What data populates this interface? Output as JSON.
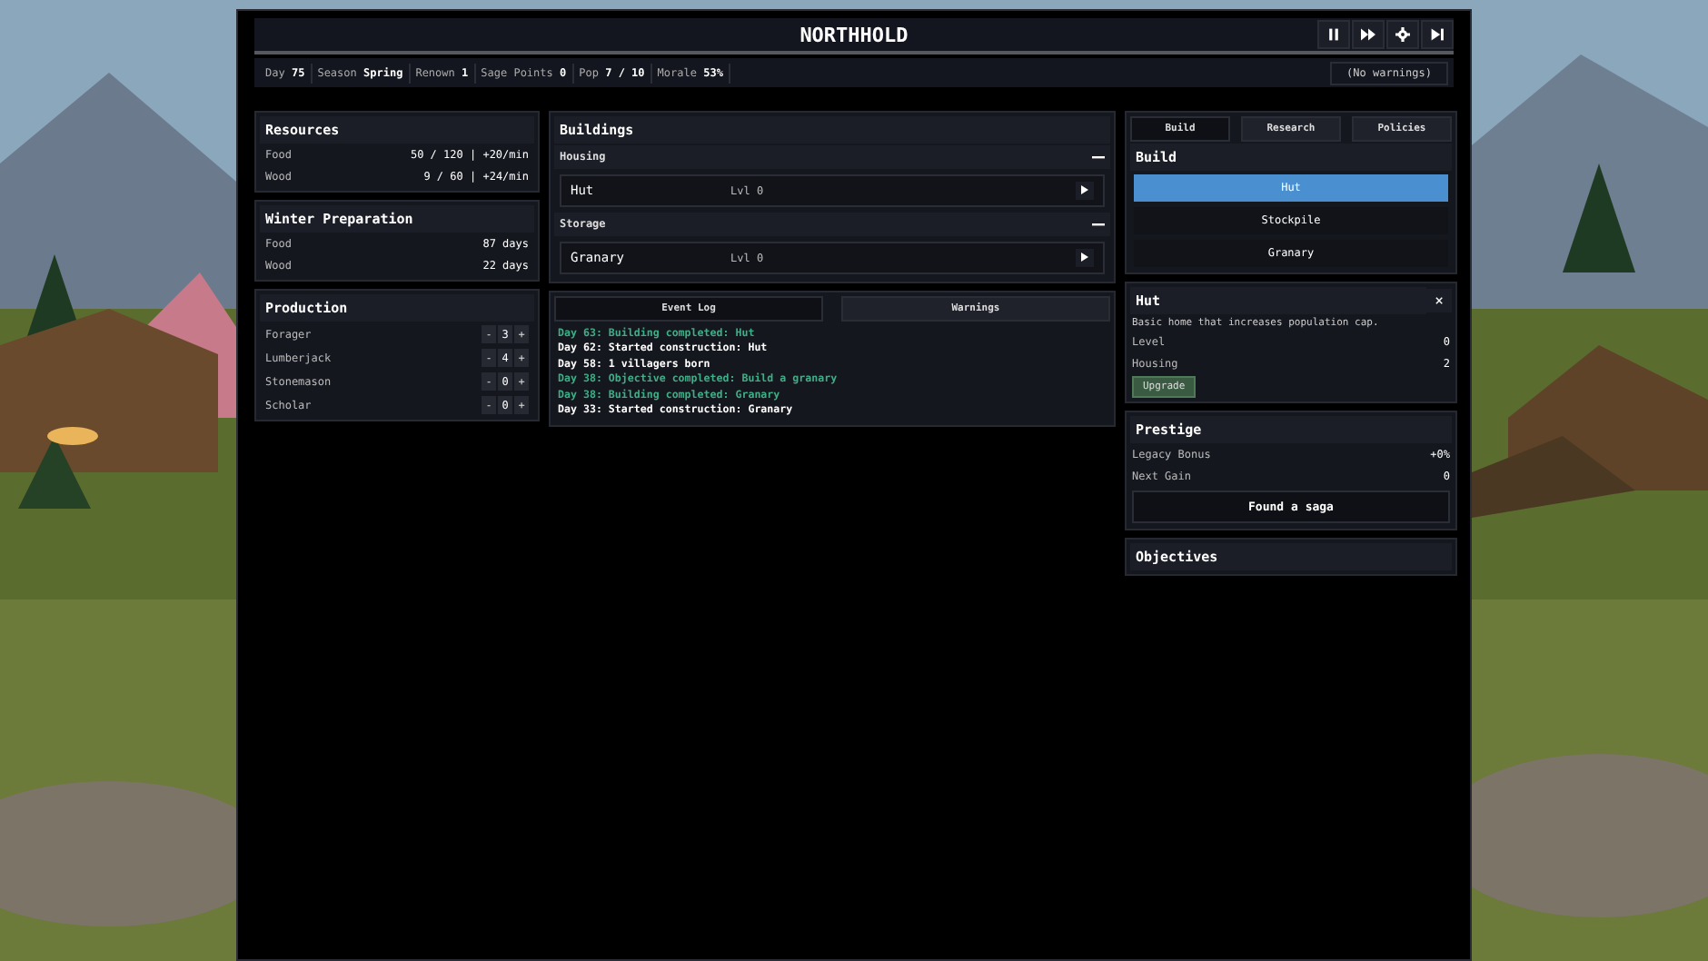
{
  "title": "NORTHHOLD",
  "controls": [
    {
      "kind": "pause"
    },
    {
      "kind": "fast"
    },
    {
      "kind": "settings"
    },
    {
      "kind": "skip"
    }
  ],
  "stats": [
    {
      "label": "Day",
      "value": "75"
    },
    {
      "label": "Season",
      "value": "Spring"
    },
    {
      "label": "Renown",
      "value": "1"
    },
    {
      "label": "Sage Points",
      "value": "0"
    },
    {
      "label": "Pop",
      "value": "7 / 10"
    },
    {
      "label": "Morale",
      "value": "53%"
    }
  ],
  "warnings_badge": "(No warnings)",
  "resources": {
    "title": "Resources",
    "rows": [
      {
        "label": "Food",
        "value": "50 / 120 | +20/min"
      },
      {
        "label": "Wood",
        "value": "9 / 60 | +24/min"
      }
    ]
  },
  "winter": {
    "title": "Winter Preparation",
    "rows": [
      {
        "label": "Food",
        "value": "87 days"
      },
      {
        "label": "Wood",
        "value": "22 days"
      }
    ]
  },
  "production": {
    "title": "Production",
    "minus": "-",
    "plus": "+",
    "rows": [
      {
        "label": "Forager",
        "count": "3"
      },
      {
        "label": "Lumberjack",
        "count": "4"
      },
      {
        "label": "Stonemason",
        "count": "0"
      },
      {
        "label": "Scholar",
        "count": "0"
      }
    ]
  },
  "buildings": {
    "title": "Buildings",
    "groups": [
      {
        "name": "Housing",
        "expanded": true,
        "items": [
          {
            "name": "Hut",
            "level": "Lvl 0"
          }
        ]
      },
      {
        "name": "Storage",
        "expanded": true,
        "items": [
          {
            "name": "Granary",
            "level": "Lvl 0"
          }
        ]
      }
    ]
  },
  "log": {
    "tabs": [
      {
        "label": "Event Log",
        "selected": true
      },
      {
        "label": "Warnings",
        "selected": false
      }
    ],
    "entries": [
      {
        "text": "Day 63: Building completed: Hut",
        "kind": "success"
      },
      {
        "text": "Day 62: Started construction: Hut",
        "kind": "info"
      },
      {
        "text": "Day 58: 1 villagers born",
        "kind": "info"
      },
      {
        "text": "Day 38: Objective completed: Build a granary",
        "kind": "success"
      },
      {
        "text": "Day 38: Building completed: Granary",
        "kind": "success"
      },
      {
        "text": "Day 33: Started construction: Granary",
        "kind": "info"
      }
    ]
  },
  "side_tabs": [
    {
      "label": "Build",
      "selected": true
    },
    {
      "label": "Research",
      "selected": false
    },
    {
      "label": "Policies",
      "selected": false
    }
  ],
  "build": {
    "title": "Build",
    "options": [
      {
        "label": "Hut",
        "selected": true
      },
      {
        "label": "Stockpile",
        "selected": false
      },
      {
        "label": "Granary",
        "selected": false
      }
    ]
  },
  "detail": {
    "title": "Hut",
    "close": "×",
    "description": "Basic home that increases population cap.",
    "rows": [
      {
        "label": "Level",
        "value": "0"
      },
      {
        "label": "Housing",
        "value": "2"
      }
    ],
    "action": "Upgrade"
  },
  "prestige": {
    "title": "Prestige",
    "rows": [
      {
        "label": "Legacy Bonus",
        "value": "+0%"
      },
      {
        "label": "Next Gain",
        "value": "0"
      }
    ],
    "action": "Found a saga"
  },
  "objectives": {
    "title": "Objectives"
  }
}
